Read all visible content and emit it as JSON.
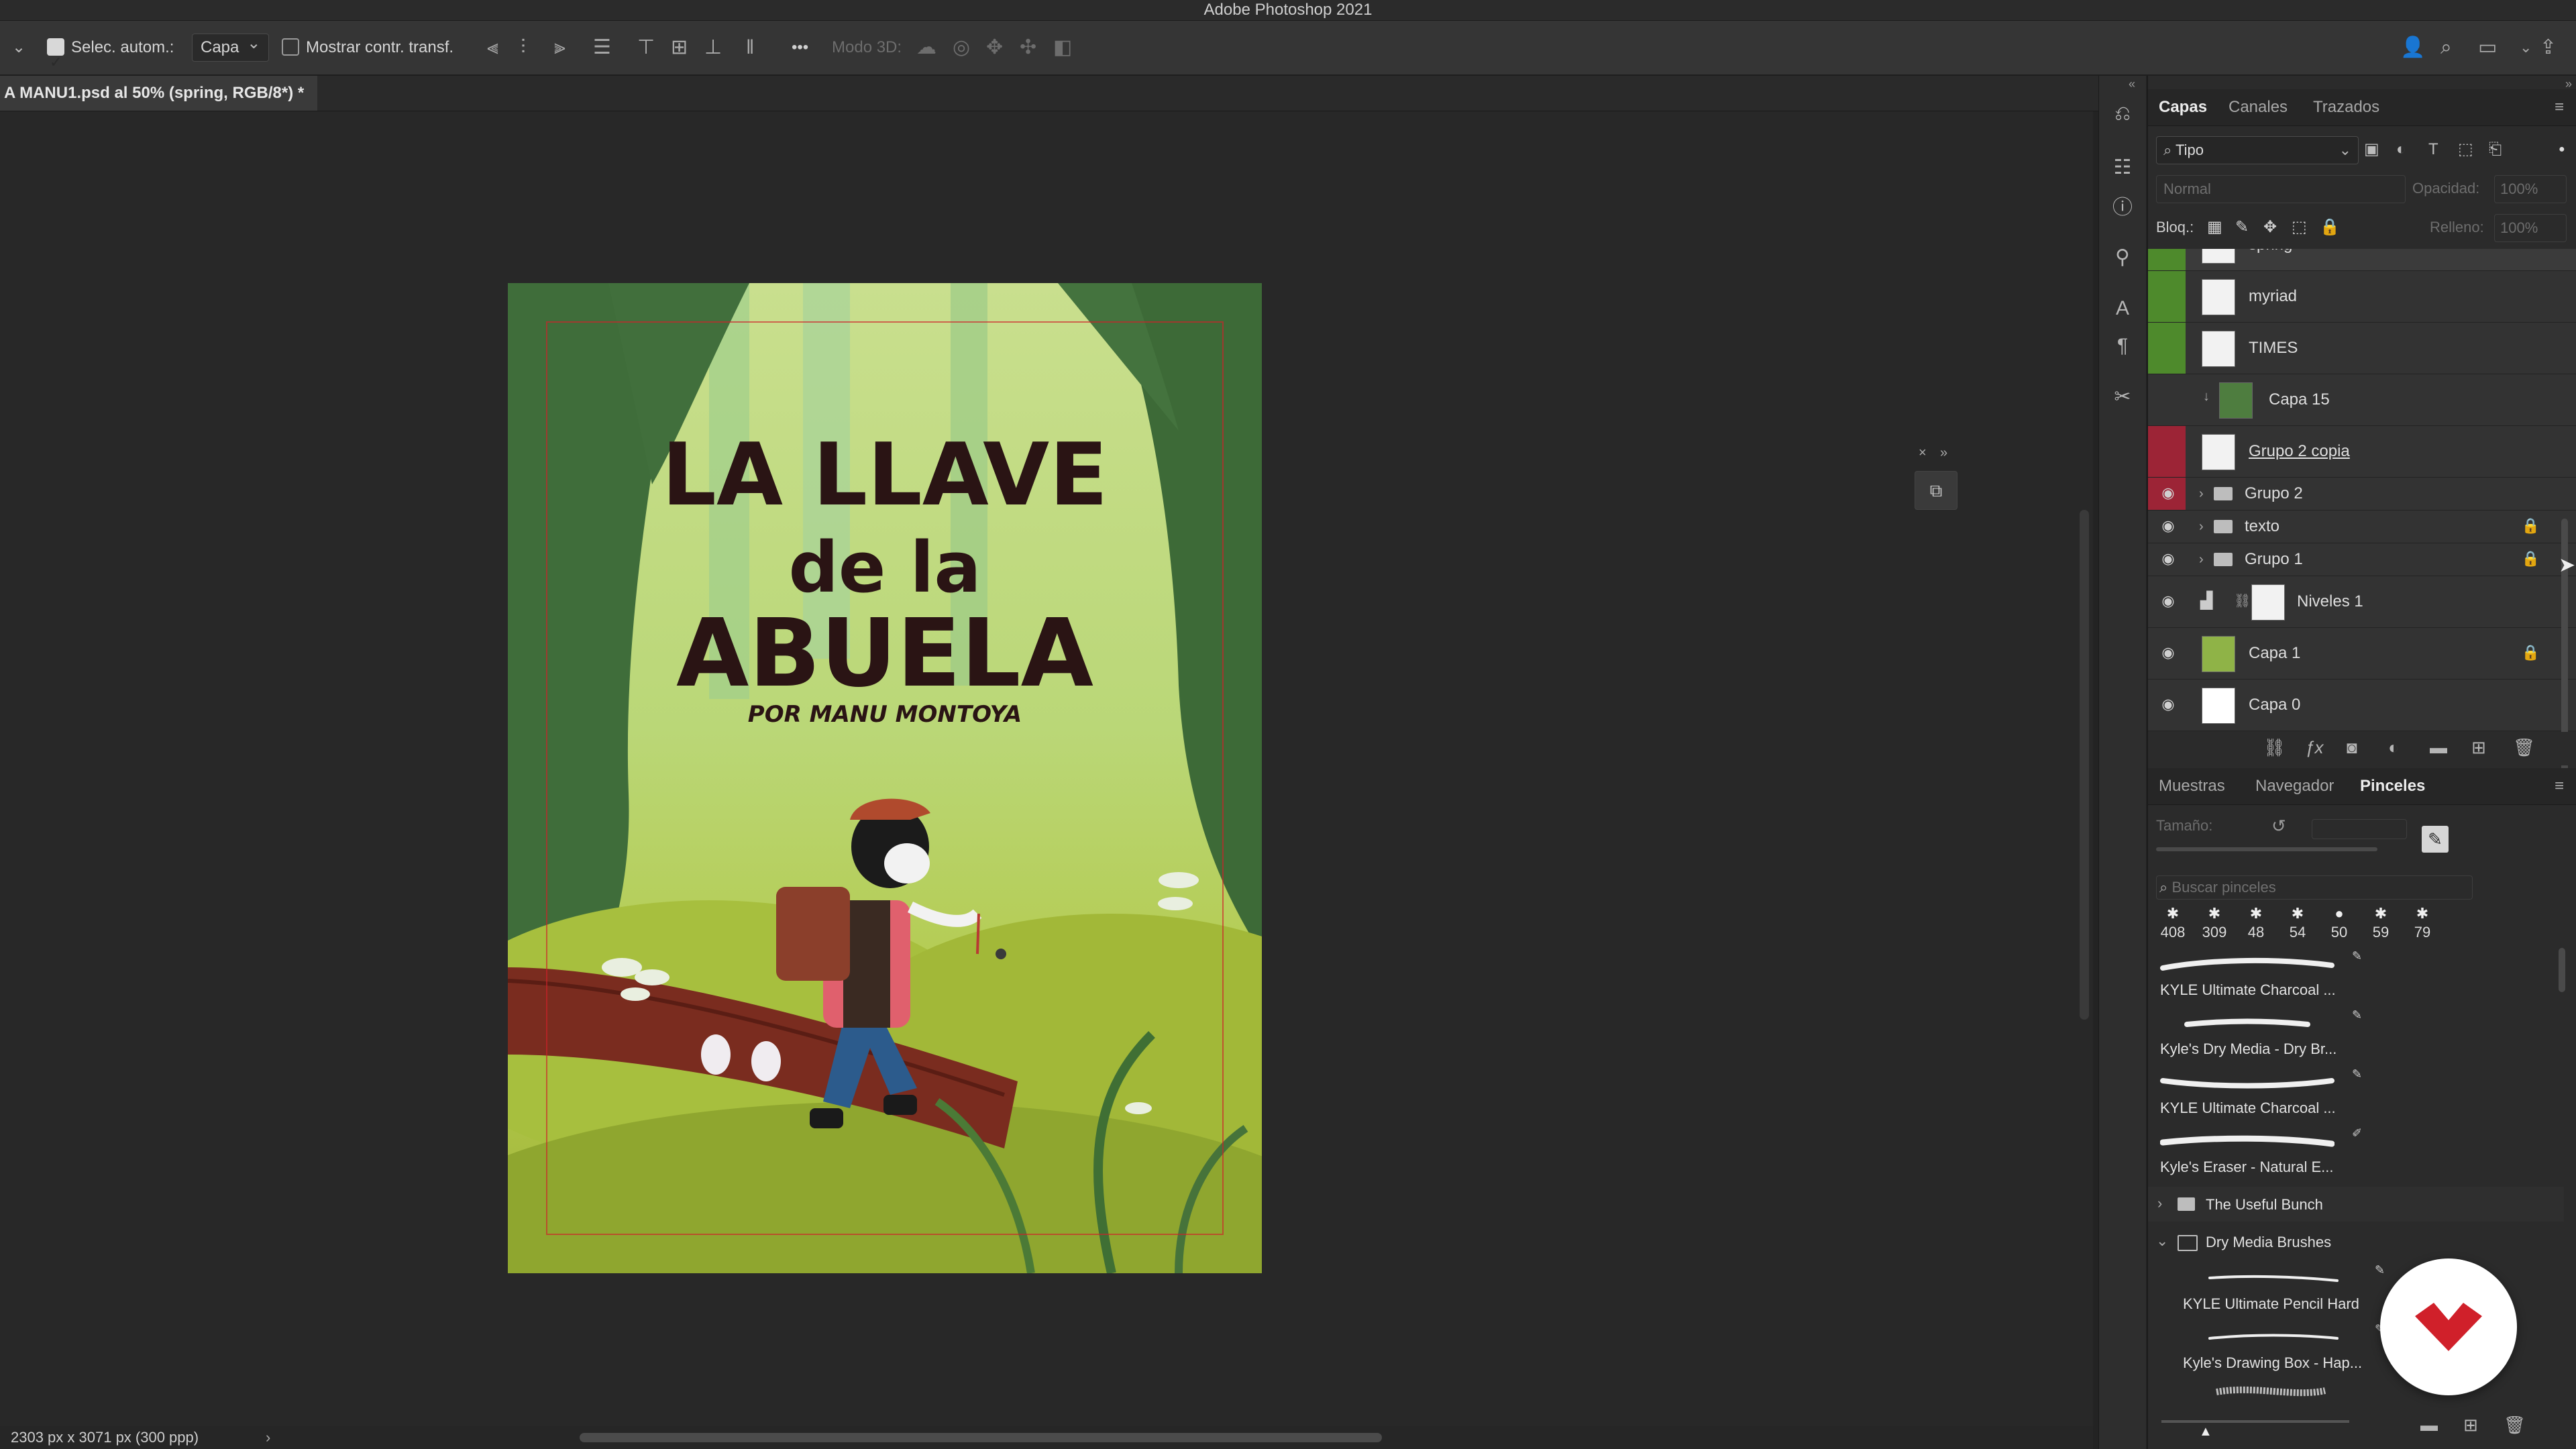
{
  "app": {
    "title": "Adobe Photoshop 2021"
  },
  "options_bar": {
    "auto_select_label": "Selec. autom.:",
    "auto_select_checked": true,
    "auto_select_target": "Capa",
    "show_transform_label": "Mostrar contr. transf.",
    "show_transform_checked": false,
    "mode3d_label": "Modo 3D:",
    "more_label": "•••"
  },
  "document": {
    "tab_title": "A MANU1.psd al 50% (spring, RGB/8*) *",
    "status": "2303 px x 3071 px (300 ppp)",
    "status_arrow": "›"
  },
  "artwork": {
    "title_line1": "LA LLAVE",
    "title_line2": "de la",
    "title_line3": "ABUELA",
    "author": "POR MANU MONTOYA"
  },
  "layers_panel": {
    "tabs": [
      "Capas",
      "Canales",
      "Trazados"
    ],
    "active_tab": "Capas",
    "filter_label": "Tipo",
    "blend_mode": "Normal",
    "opacity_label": "Opacidad:",
    "opacity_value": "100%",
    "lock_label": "Bloq.:",
    "fill_label": "Relleno:",
    "fill_value": "100%",
    "layers": [
      {
        "name": "spring",
        "color": "#4e8a2c",
        "visible": false,
        "type": "text",
        "partial": true
      },
      {
        "name": "myriad",
        "color": "#4e8a2c",
        "visible": false,
        "type": "text"
      },
      {
        "name": "TIMES",
        "color": "#4e8a2c",
        "visible": false,
        "type": "text"
      },
      {
        "name": "Capa 15",
        "color": "",
        "visible": false,
        "type": "clipped"
      },
      {
        "name": "Grupo 2 copia",
        "color": "#9c2436",
        "visible": false,
        "type": "text",
        "underlined": true
      },
      {
        "name": "Grupo 2",
        "color": "#9c2436",
        "visible": true,
        "type": "group"
      },
      {
        "name": "texto",
        "color": "",
        "visible": true,
        "type": "group",
        "locked": true
      },
      {
        "name": "Grupo 1",
        "color": "",
        "visible": true,
        "type": "group",
        "locked": true
      },
      {
        "name": "Niveles 1",
        "color": "",
        "visible": true,
        "type": "adjustment"
      },
      {
        "name": "Capa 1",
        "color": "",
        "visible": true,
        "type": "image",
        "locked": true
      },
      {
        "name": "Capa 0",
        "color": "",
        "visible": true,
        "type": "white"
      }
    ]
  },
  "brushes_panel": {
    "tabs": [
      "Muestras",
      "Navegador",
      "Pinceles"
    ],
    "active_tab": "Pinceles",
    "size_label": "Tamaño:",
    "search_placeholder": "Buscar pinceles",
    "presets": [
      "408",
      "309",
      "48",
      "54",
      "50",
      "59",
      "79"
    ],
    "brushes": [
      "KYLE Ultimate Charcoal ...",
      "Kyle's Dry Media - Dry Br...",
      "KYLE Ultimate Charcoal ...",
      "Kyle's Eraser - Natural E..."
    ],
    "groups": [
      {
        "name": "The Useful Bunch",
        "expanded": false
      },
      {
        "name": "Dry Media Brushes",
        "expanded": true
      }
    ],
    "group_brushes": [
      "KYLE Ultimate Pencil Hard",
      "Kyle's Drawing Box - Hap..."
    ]
  },
  "colors": {
    "accent_red": "#d0202a",
    "label_green": "#4e8a2c",
    "label_red": "#9c2436"
  }
}
